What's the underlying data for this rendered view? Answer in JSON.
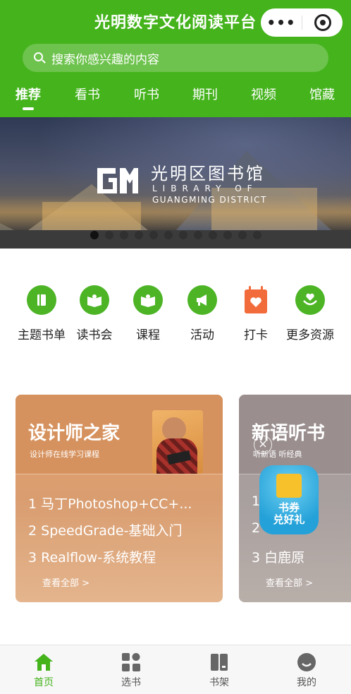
{
  "header": {
    "title": "光明数字文化阅读平台",
    "capsule_more": "•••",
    "search_placeholder": "搜索你感兴趣的内容"
  },
  "tabs": [
    {
      "label": "推荐",
      "active": true
    },
    {
      "label": "看书"
    },
    {
      "label": "听书"
    },
    {
      "label": "期刊"
    },
    {
      "label": "视频"
    },
    {
      "label": "馆藏"
    }
  ],
  "banner": {
    "name": "光明区图书馆",
    "en_line1": "LIBRARY OF",
    "en_line2": "GUANGMING DISTRICT",
    "slide_count": 12,
    "active_slide": 0
  },
  "quick_links": [
    {
      "label": "主题书单",
      "icon": "book-list-icon"
    },
    {
      "label": "读书会",
      "icon": "reading-club-icon"
    },
    {
      "label": "课程",
      "icon": "course-icon"
    },
    {
      "label": "活动",
      "icon": "megaphone-icon"
    },
    {
      "label": "打卡",
      "icon": "calendar-heart-icon"
    },
    {
      "label": "更多资源",
      "icon": "hand-heart-icon"
    }
  ],
  "cards": [
    {
      "title": "设计师之家",
      "subtitle": "设计师在线学习课程",
      "items": [
        "1  马丁Photoshop+CC+...",
        "2  SpeedGrade-基础入门",
        "3  Realflow-系统教程"
      ],
      "more": "查看全部  >"
    },
    {
      "title": "新语听书",
      "subtitle": "听新语  听经典",
      "items": [
        "1",
        "2",
        "3  白鹿原"
      ],
      "more": "查看全部  >"
    }
  ],
  "floating_ad": {
    "close": "×",
    "line1": "书券",
    "line2": "兑好礼"
  },
  "tabbar": [
    {
      "label": "首页",
      "icon": "home-icon",
      "active": true
    },
    {
      "label": "选书",
      "icon": "grid-icon"
    },
    {
      "label": "书架",
      "icon": "bookshelf-icon"
    },
    {
      "label": "我的",
      "icon": "profile-icon"
    }
  ],
  "colors": {
    "brand_green": "#44b31c",
    "icon_green": "#4cb425",
    "checkin_orange": "#f26b3a"
  }
}
